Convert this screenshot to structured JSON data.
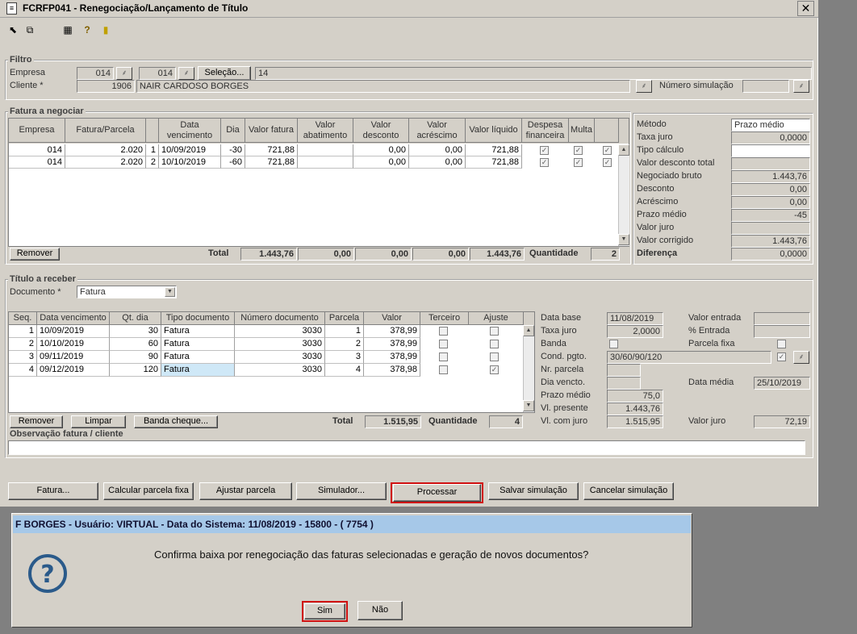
{
  "window": {
    "title": "FCRFP041 - Renegociação/Lançamento de Título",
    "close": "✕"
  },
  "toolbar": {
    "icons": [
      "arrow-icon",
      "copy-icon",
      "grid-icon",
      "help-icon",
      "exit-icon"
    ]
  },
  "filtro": {
    "label": "Filtro",
    "empresa_label": "Empresa",
    "empresa1": "014",
    "empresa2": "014",
    "selecao_label": "Seleção...",
    "selecao_value": "14",
    "cliente_label": "Cliente *",
    "cliente_code": "1906",
    "cliente_name": "NAIR CARDOSO BORGES",
    "num_sim_label": "Número simulação",
    "num_sim_value": ""
  },
  "fatura": {
    "label": "Fatura a negociar",
    "headers": [
      "Empresa",
      "Fatura/Parcela",
      "",
      "Data vencimento",
      "Dia",
      "Valor fatura",
      "Valor abatimento",
      "Valor desconto",
      "Valor acréscimo",
      "Valor líquido",
      "Despesa financeira",
      "Multa",
      ""
    ],
    "rows": [
      [
        "014",
        "2.020",
        "1",
        "10/09/2019",
        "-30",
        "721,88",
        "",
        "0,00",
        "0,00",
        "721,88"
      ],
      [
        "014",
        "2.020",
        "2",
        "10/10/2019",
        "-60",
        "721,88",
        "",
        "0,00",
        "0,00",
        "721,88"
      ]
    ],
    "remover": "Remover",
    "total_label": "Total",
    "total_fatura": "1.443,76",
    "total_abat": "0,00",
    "total_desc": "0,00",
    "total_acres": "0,00",
    "total_liq": "1.443,76",
    "qtd_label": "Quantidade",
    "qtd": "2"
  },
  "metodo": {
    "metodo_label": "Método",
    "metodo_value": "Prazo médio",
    "taxa_label": "Taxa juro",
    "taxa_value": "0,0000",
    "tipo_label": "Tipo cálculo",
    "tipo_value": "",
    "vdt_label": "Valor desconto total",
    "vdt_value": "",
    "nb_label": "Negociado bruto",
    "nb_value": "1.443,76",
    "desc_label": "Desconto",
    "desc_value": "0,00",
    "acr_label": "Acréscimo",
    "acr_value": "0,00",
    "pm_label": "Prazo médio",
    "pm_value": "-45",
    "vj_label": "Valor juro",
    "vj_value": "",
    "vc_label": "Valor corrigido",
    "vc_value": "1.443,76",
    "dif_label": "Diferença",
    "dif_value": "0,0000"
  },
  "titulo": {
    "label": "Título a receber",
    "doc_label": "Documento *",
    "doc_value": "Fatura",
    "headers": [
      "Seq.",
      "Data vencimento",
      "Qt. dia",
      "Tipo documento",
      "Número documento",
      "Parcela",
      "Valor",
      "Terceiro",
      "Ajuste"
    ],
    "rows": [
      [
        "1",
        "10/09/2019",
        "30",
        "Fatura",
        "3030",
        "1",
        "378,99"
      ],
      [
        "2",
        "10/10/2019",
        "60",
        "Fatura",
        "3030",
        "2",
        "378,99"
      ],
      [
        "3",
        "09/11/2019",
        "90",
        "Fatura",
        "3030",
        "3",
        "378,99"
      ],
      [
        "4",
        "09/12/2019",
        "120",
        "Fatura",
        "3030",
        "4",
        "378,98"
      ]
    ],
    "remover": "Remover",
    "limpar": "Limpar",
    "banda": "Banda cheque...",
    "total_label": "Total",
    "total": "1.515,95",
    "qtd_label": "Quantidade",
    "qtd": "4"
  },
  "info": {
    "db_label": "Data base",
    "db_value": "11/08/2019",
    "tj_label": "Taxa juro",
    "tj_value": "2,0000",
    "banda_label": "Banda",
    "cp_label": "Cond. pgto.",
    "cp_value": "30/60/90/120",
    "np_label": "Nr. parcela",
    "np_value": "",
    "dv_label": "Dia vencto.",
    "dv_value": "",
    "pm_label": "Prazo médio",
    "pm_value": "75,0",
    "vp_label": "Vl. presente",
    "vp_value": "1.443,76",
    "vcj_label": "Vl. com juro",
    "vcj_value": "1.515,95",
    "ve_label": "Valor entrada",
    "ve_value": "",
    "pe_label": "% Entrada",
    "pe_value": "",
    "pf_label": "Parcela fixa",
    "dm_label": "Data média",
    "dm_value": "25/10/2019",
    "vju_label": "Valor juro",
    "vju_value": "72,19"
  },
  "obs": {
    "label": "Observação fatura / cliente",
    "value": ""
  },
  "buttons": {
    "fatura": "Fatura...",
    "calc": "Calcular parcela fixa",
    "ajustar": "Ajustar parcela",
    "simulador": "Simulador...",
    "processar": "Processar",
    "salvar": "Salvar simulação",
    "cancelar": "Cancelar simulação"
  },
  "dialog": {
    "title": "F BORGES - Usuário: VIRTUAL - Data do Sistema: 11/08/2019 - 15800 - ( 7754 )",
    "message": "Confirma baixa por renegociação das faturas selecionadas e geração de novos documentos?",
    "sim": "Sim",
    "nao": "Não"
  },
  "colors": {
    "highlight": "#d01010",
    "dialog_title": "#a6c8e8",
    "question_icon": "#2a5a8a"
  }
}
